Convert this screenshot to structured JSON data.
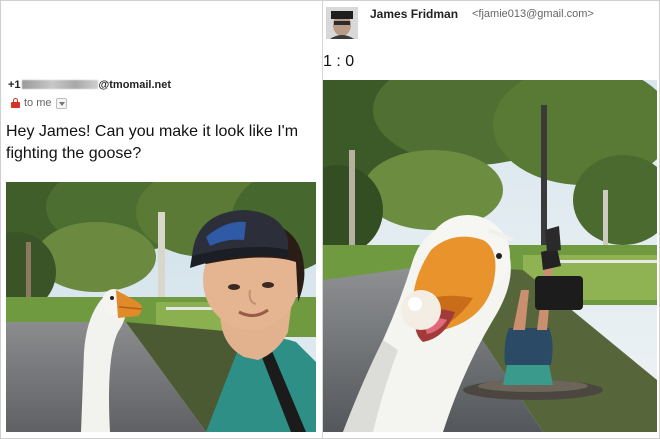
{
  "left_email": {
    "sender_prefix": "+1",
    "sender_suffix": "@tmomail.net",
    "recipient_label": "to me",
    "message": "Hey James! Can you make it look like I'm fighting the goose?"
  },
  "right_email": {
    "from_name": "James Fridman",
    "from_email": "<fjamie013@gmail.com>",
    "reply": "1 : 0"
  },
  "colors": {
    "lock": "#d93025",
    "sky": "#bcd6e6",
    "grass": "#6f9a3f",
    "path": "#6d6f72"
  }
}
